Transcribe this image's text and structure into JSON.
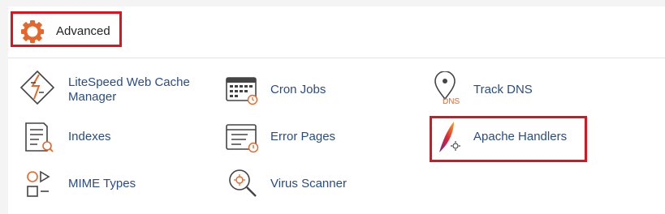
{
  "section": {
    "title": "Advanced",
    "icon": "gear-icon"
  },
  "items": [
    {
      "label_line1": "LiteSpeed Web Cache",
      "label_line2": "Manager",
      "icon": "litespeed-icon"
    },
    {
      "label": "Cron Jobs",
      "icon": "cron-jobs-icon"
    },
    {
      "label": "Track DNS",
      "icon": "track-dns-icon",
      "icon_text": "DNS"
    },
    {
      "label": "Indexes",
      "icon": "indexes-icon"
    },
    {
      "label": "Error Pages",
      "icon": "error-pages-icon"
    },
    {
      "label": "Apache Handlers",
      "icon": "apache-feather-icon"
    },
    {
      "label": "MIME Types",
      "icon": "mime-types-icon"
    },
    {
      "label": "Virus Scanner",
      "icon": "virus-scanner-icon"
    }
  ],
  "colors": {
    "highlight": "#e0121d",
    "link": "#294c86",
    "accent": "#e5672b"
  }
}
